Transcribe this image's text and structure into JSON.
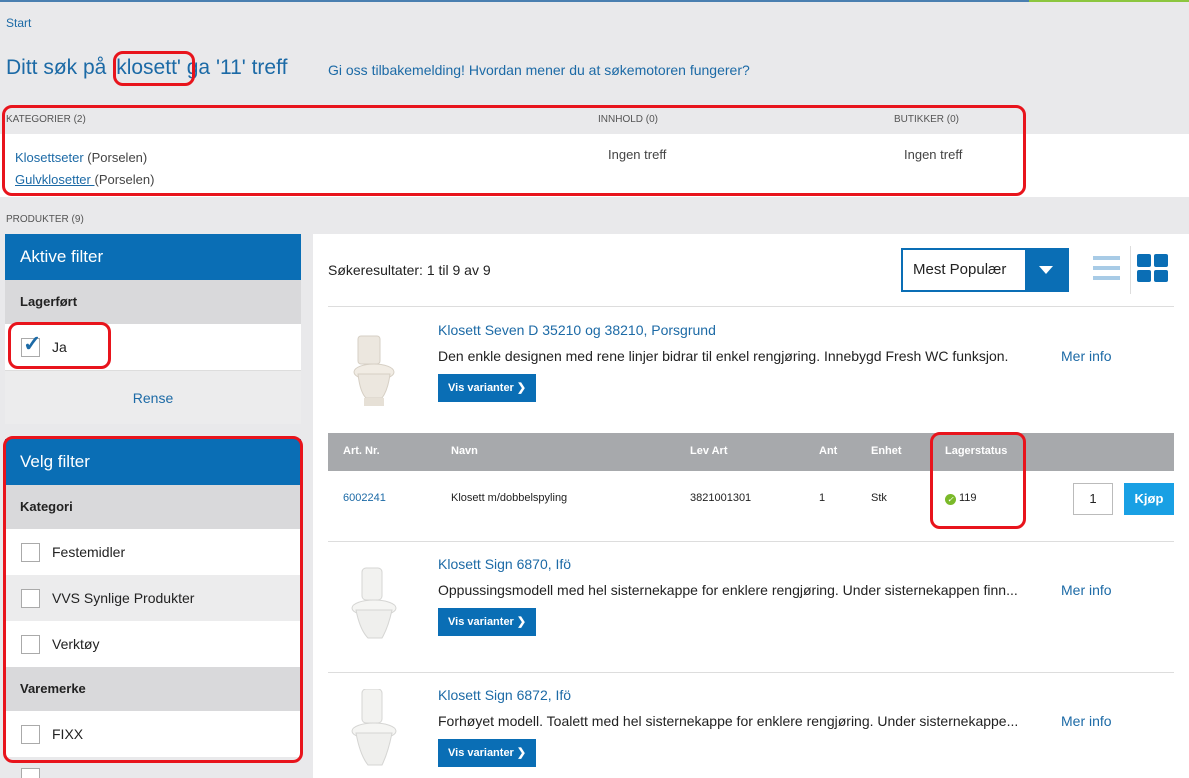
{
  "breadcrumb": {
    "start": "Start"
  },
  "search": {
    "prefix": "Ditt søk på ",
    "query": "'klosett'",
    "suffix": " ga '11' treff",
    "feedback_link": "Gi oss tilbakemelding! Hvordan mener du at søkemotoren fungerer?"
  },
  "sections": {
    "kategorier": "KATEGORIER (2)",
    "innhold": "INNHOLD (0)",
    "butikker": "BUTIKKER (0)",
    "produkter": "PRODUKTER (9)"
  },
  "categories": [
    {
      "name": "Klosettseter",
      "parent": " (Porselen)"
    },
    {
      "name": "Gulvklosetter ",
      "parent": "(Porselen)"
    }
  ],
  "no_results": {
    "innhold": "Ingen treff",
    "butikker": "Ingen treff"
  },
  "active_filter": {
    "title": "Aktive filter",
    "group": "Lagerført",
    "option": "Ja",
    "clear": "Rense"
  },
  "choose_filter": {
    "title": "Velg filter",
    "kategori_label": "Kategori",
    "kategori_options": [
      "Festemidler",
      "VVS Synlige Produkter",
      "Verktøy"
    ],
    "varemerke_label": "Varemerke",
    "varemerke_options": [
      "FIXX"
    ]
  },
  "results": {
    "count_text": "Søkeresultater: 1 til 9 av 9",
    "sort_selected": "Mest Populær"
  },
  "products": [
    {
      "title": "Klosett Seven D 35210 og 38210, Porsgrund",
      "desc": "Den enkle designen med rene linjer bidrar til enkel rengjøring. Innebygd Fresh WC funksjon.",
      "more": "Mer info",
      "variants_btn": "Vis varianter"
    },
    {
      "title": "Klosett Sign 6870, Ifö",
      "desc": "Oppussingsmodell med hel sisternekappe for enklere rengjøring. Under sisternekappen finn...",
      "more": "Mer info",
      "variants_btn": "Vis varianter"
    },
    {
      "title": "Klosett Sign 6872, Ifö",
      "desc": "Forhøyet modell. Toalett med hel sisternekappe for enklere rengjøring. Under sisternekappe...",
      "more": "Mer info",
      "variants_btn": "Vis varianter"
    }
  ],
  "variant_table": {
    "headers": {
      "artnr": "Art. Nr.",
      "navn": "Navn",
      "levart": "Lev Art",
      "ant": "Ant",
      "enhet": "Enhet",
      "lager": "Lagerstatus"
    },
    "row": {
      "artnr": "6002241",
      "navn": "Klosett m/dobbelspyling",
      "levart": "3821001301",
      "ant": "1",
      "enhet": "Stk",
      "lager": "119",
      "qty": "1",
      "buy": "Kjøp"
    }
  },
  "colors": {
    "primary": "#0a6eb5",
    "link": "#1c6aa6",
    "highlight": "#e8141c",
    "buy": "#19a0e4",
    "in_stock": "#7ab929"
  }
}
